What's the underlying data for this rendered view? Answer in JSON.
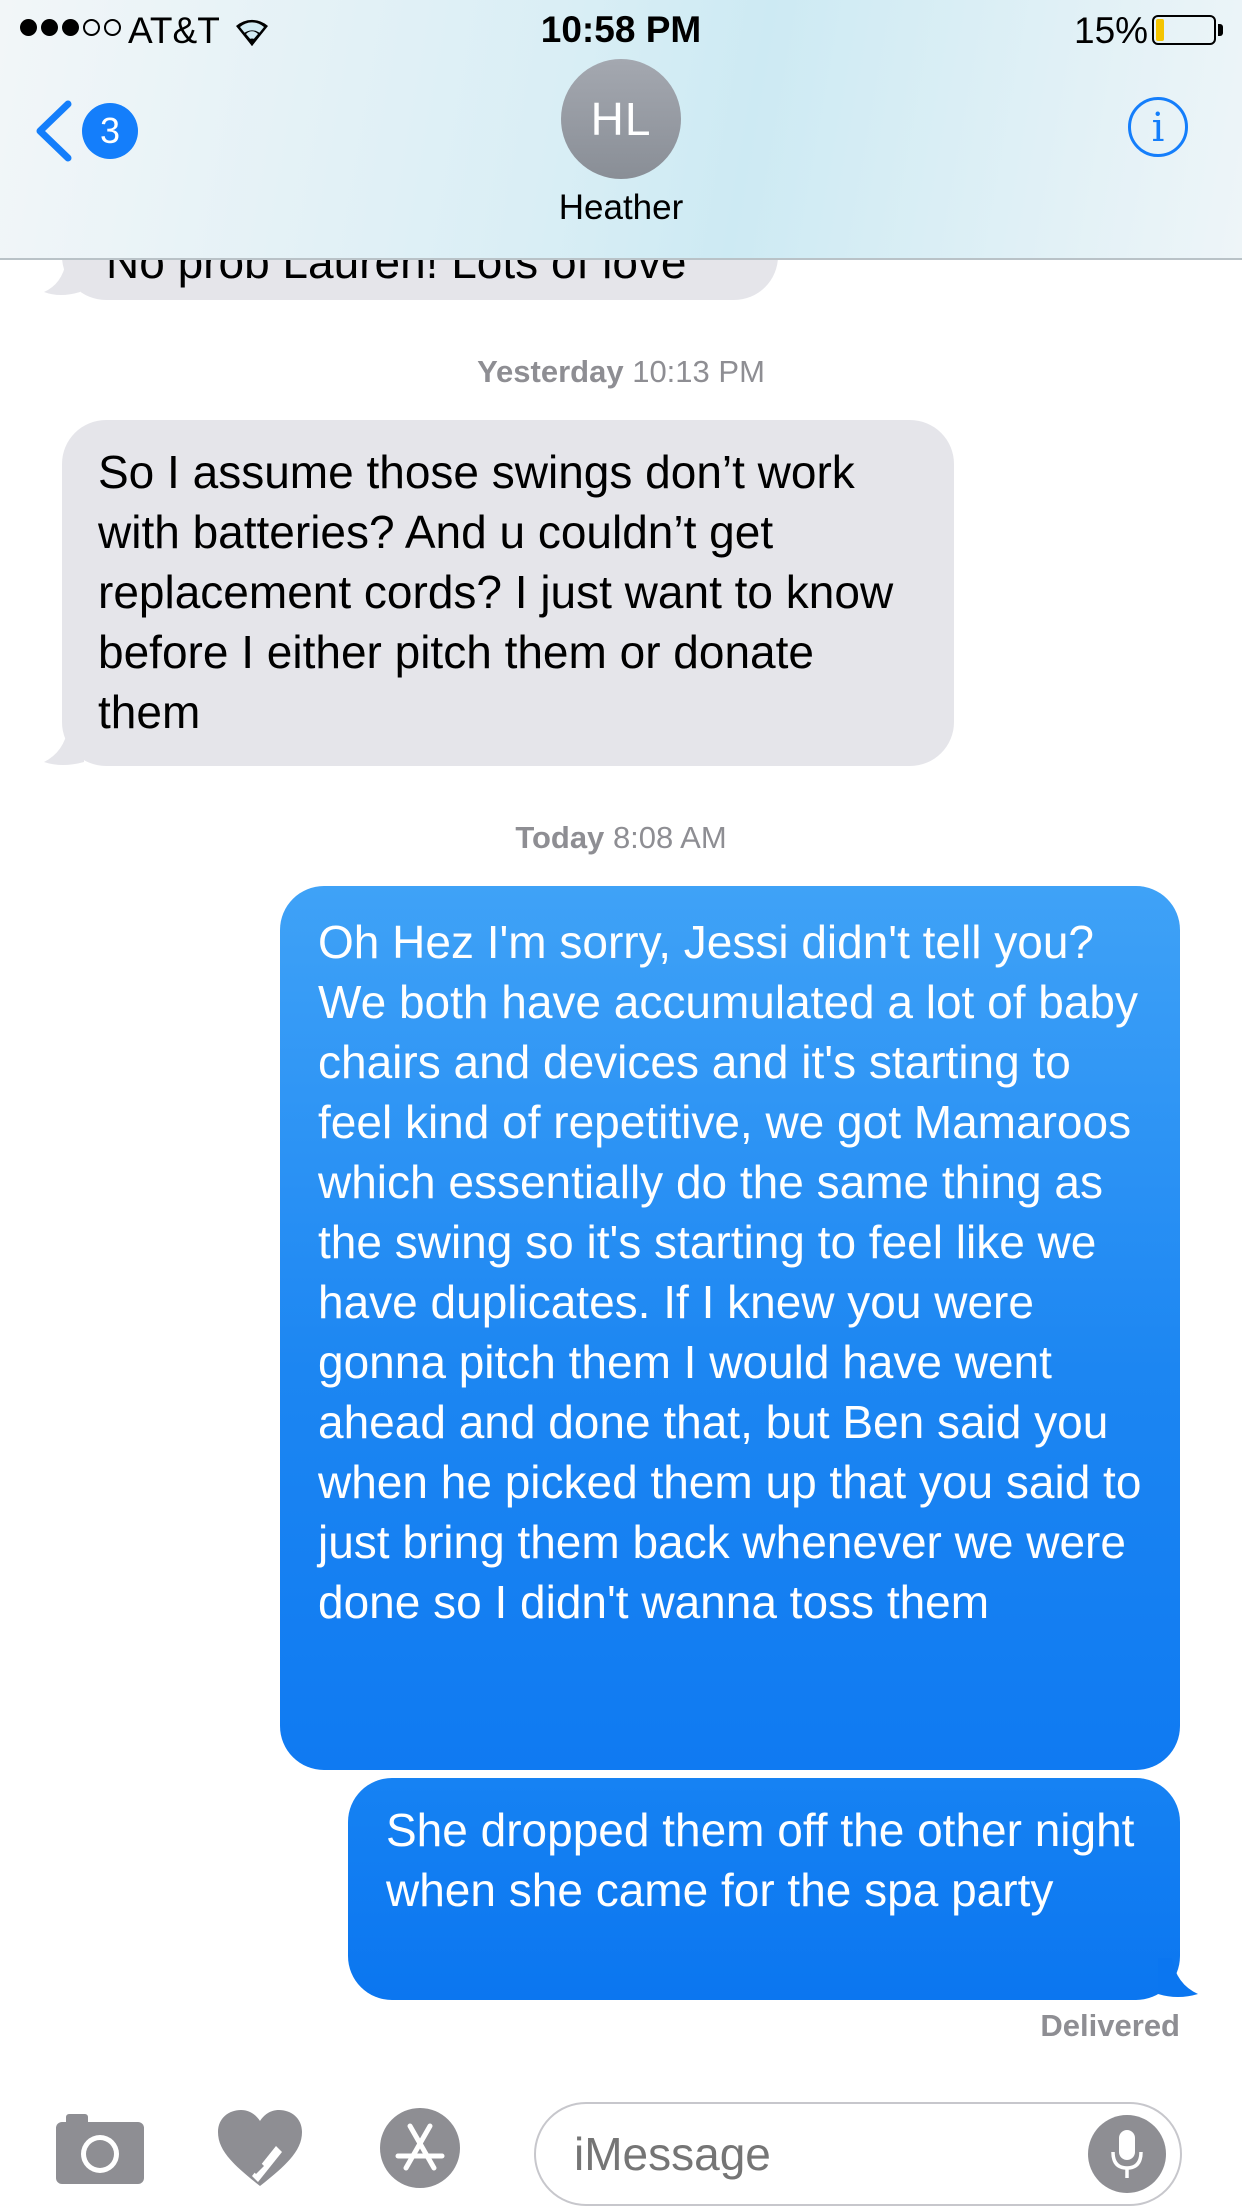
{
  "status_bar": {
    "carrier": "AT&T",
    "time": "10:58 PM",
    "battery_percent": "15%",
    "battery_level": 0.15,
    "signal_bars_filled": 3,
    "signal_bars_total": 5
  },
  "header": {
    "back_badge_count": "3",
    "avatar_initials": "HL",
    "contact_name": "Heather",
    "info_icon_glyph": "i"
  },
  "messages": {
    "partial_previous": "No prob Lauren! Lots of love",
    "timestamp_1": {
      "day": "Yesterday",
      "time": "10:13 PM"
    },
    "incoming_1": "So I assume those swings don’t work with batteries? And u couldn’t get replacement cords? I just want to know before I either pitch them or donate them",
    "timestamp_2": {
      "day": "Today",
      "time": "8:08 AM"
    },
    "outgoing_1": "Oh Hez I'm sorry, Jessi didn't tell you? We both have accumulated a lot of baby chairs and devices and it's starting to feel kind of repetitive, we got Mamaroos which essentially do the same thing as the swing so it's starting to feel like we have duplicates. If I knew you were gonna pitch them I would have went ahead and done that, but Ben said you when he picked them up that you said to just bring them back whenever we were done so I didn't wanna toss them",
    "outgoing_2": "She dropped them off the other night when she came for the spa party",
    "delivered_label": "Delivered"
  },
  "toolbar": {
    "input_placeholder": "iMessage",
    "icons": [
      "camera-icon",
      "digital-touch-heart-icon",
      "app-store-icon",
      "microphone-icon"
    ]
  },
  "colors": {
    "ios_blue": "#147efb",
    "bubble_gray": "#e5e5ea",
    "timestamp_gray": "#8e8e93",
    "battery_yellow": "#f4c400"
  }
}
